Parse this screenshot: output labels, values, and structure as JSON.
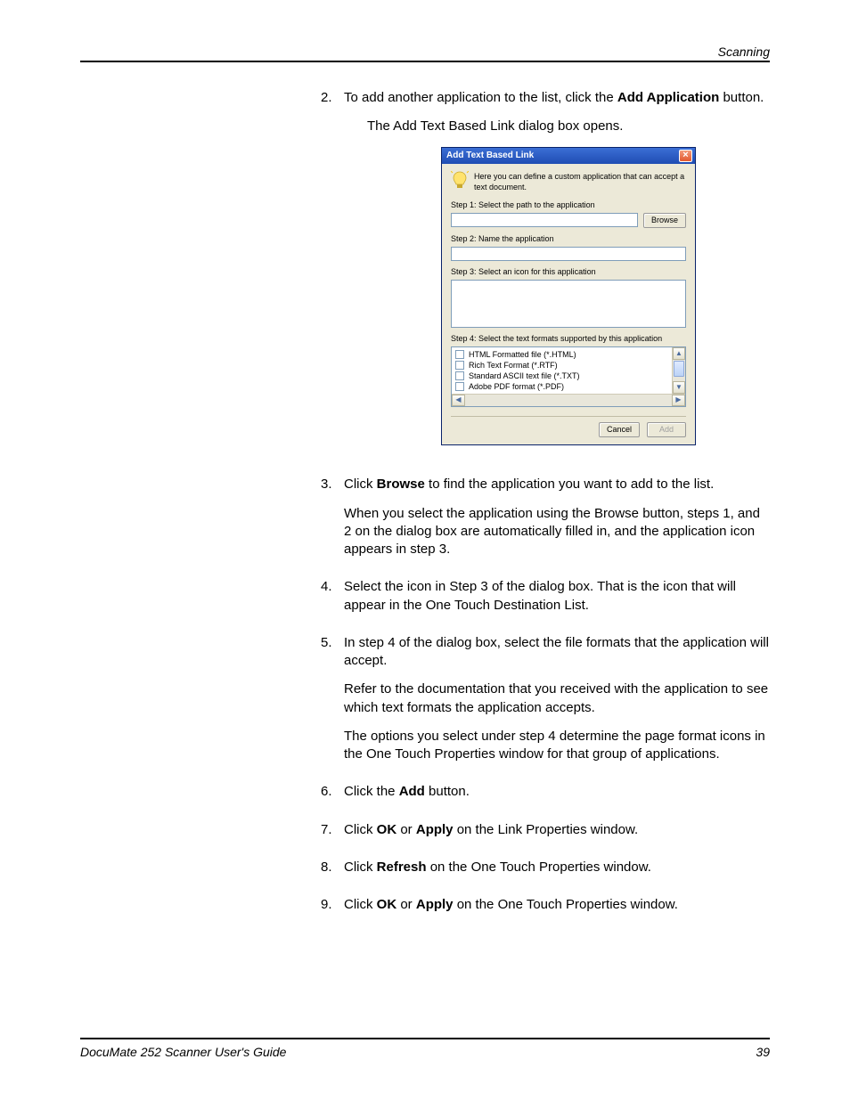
{
  "header": {
    "section": "Scanning"
  },
  "s2": {
    "num": "2.",
    "prefix": "To add another application to the list, click the ",
    "bold": "Add Application",
    "suffix": " button.",
    "sub": "The Add Text Based Link dialog box opens."
  },
  "dialog": {
    "title": "Add Text Based Link",
    "intro": "Here you can define a custom application that can accept a text document.",
    "step1": "Step 1: Select the path to the application",
    "browse": "Browse",
    "step2": "Step 2: Name the application",
    "step3": "Step 3: Select an icon for this application",
    "step4": "Step 4: Select the text formats supported by this application",
    "formats": [
      "HTML Formatted file (*.HTML)",
      "Rich Text Format (*.RTF)",
      "Standard ASCII text file (*.TXT)",
      "Adobe PDF format (*.PDF)"
    ],
    "cancel": "Cancel",
    "add": "Add"
  },
  "s3": {
    "num": "3.",
    "prefix": "Click ",
    "bold": "Browse",
    "suffix": " to find the application you want to add to the list.",
    "p2": "When you select the application using the Browse button, steps 1, and 2 on the dialog box are automatically filled in, and the application icon appears in step 3."
  },
  "s4": {
    "num": "4.",
    "text": "Select the icon in Step 3 of the dialog box. That is the icon that will appear in the One Touch Destination List."
  },
  "s5": {
    "num": "5.",
    "p1": "In step 4 of the dialog box, select the file formats that the application will accept.",
    "p2": "Refer to the documentation that you received with the application to see which text formats the application accepts.",
    "p3": "The options you select under step 4 determine the page format icons in the One Touch Properties window for that group of applications."
  },
  "s6": {
    "num": "6.",
    "prefix": "Click the ",
    "bold": "Add",
    "suffix": " button."
  },
  "s7": {
    "num": "7.",
    "p1": "Click ",
    "b1": "OK",
    "mid": " or ",
    "b2": "Apply",
    "p2": " on the Link Properties window."
  },
  "s8": {
    "num": "8.",
    "p1": "Click ",
    "b1": "Refresh",
    "p2": " on the One Touch Properties window."
  },
  "s9": {
    "num": "9.",
    "p1": "Click ",
    "b1": "OK",
    "mid": " or ",
    "b2": "Apply",
    "p2": " on the One Touch Properties window."
  },
  "footer": {
    "title": "DocuMate 252 Scanner User's Guide",
    "page": "39"
  }
}
